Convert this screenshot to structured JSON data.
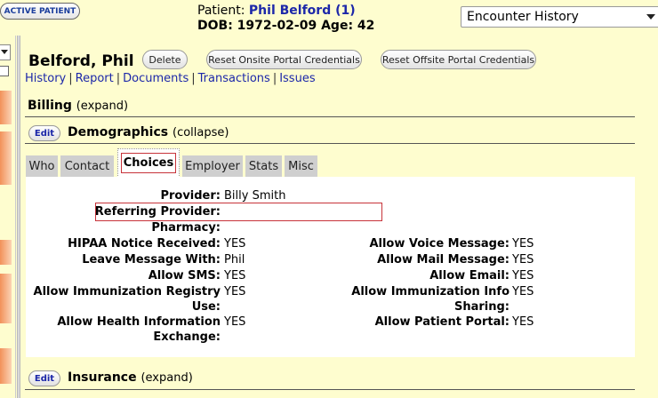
{
  "header": {
    "active_patient_label": "ACTIVE PATIENT",
    "patient_prefix": "Patient:",
    "patient_name": "Phil Belford (1)",
    "dob_line": "DOB: 1972-02-09 Age: 42",
    "encounter_select": "Encounter History"
  },
  "patient": {
    "name": "Belford, Phil",
    "buttons": {
      "delete": "Delete",
      "reset_onsite": "Reset Onsite Portal Credentials",
      "reset_offsite": "Reset Offsite Portal Credentials"
    },
    "links": [
      "History",
      "Report",
      "Documents",
      "Transactions",
      "Issues"
    ],
    "link_separator": "|"
  },
  "sections": {
    "billing": {
      "title": "Billing",
      "toggle": "(expand)"
    },
    "demographics": {
      "edit": "Edit",
      "title": "Demographics",
      "toggle": "(collapse)"
    },
    "insurance": {
      "edit": "Edit",
      "title": "Insurance",
      "toggle": "(expand)"
    }
  },
  "tabs": [
    "Who",
    "Contact",
    "Choices",
    "Employer",
    "Stats",
    "Misc"
  ],
  "active_tab": "Choices",
  "choices": {
    "provider": {
      "label": "Provider:",
      "value": "Billy Smith"
    },
    "referring_provider": {
      "label": "Referring Provider:",
      "value": ""
    },
    "pharmacy": {
      "label": "Pharmacy:",
      "value": ""
    },
    "left": [
      {
        "label": "HIPAA Notice Received:",
        "value": "YES"
      },
      {
        "label": "Leave Message With:",
        "value": "Phil"
      },
      {
        "label": "Allow SMS:",
        "value": "YES"
      },
      {
        "label": "Allow Immunization Registry Use:",
        "value": "YES"
      },
      {
        "label": "Allow Health Information Exchange:",
        "value": "YES"
      }
    ],
    "right": [
      {
        "label": "Allow Voice Message:",
        "value": "YES"
      },
      {
        "label": "Allow Mail Message:",
        "value": "YES"
      },
      {
        "label": "Allow Email:",
        "value": "YES"
      },
      {
        "label": "Allow Immunization Info Sharing:",
        "value": "YES"
      },
      {
        "label": "Allow Patient Portal:",
        "value": "YES"
      }
    ]
  }
}
